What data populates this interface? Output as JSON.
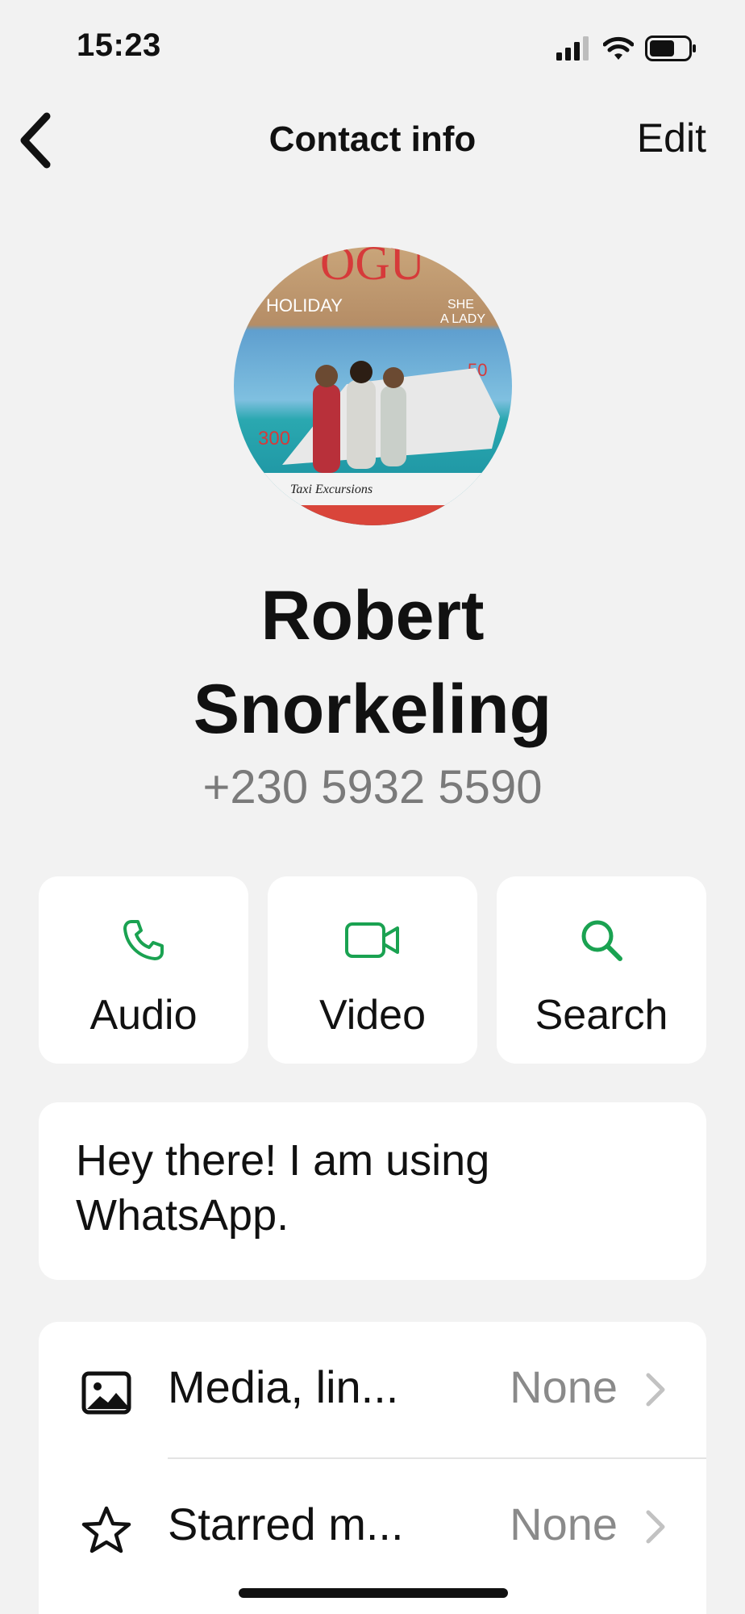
{
  "status_bar": {
    "time": "15:23"
  },
  "nav": {
    "title": "Contact info",
    "edit_label": "Edit"
  },
  "contact": {
    "name": "Robert Snorkeling",
    "phone": "+230 5932 5590"
  },
  "actions": [
    {
      "label": "Audio",
      "icon": "phone-icon"
    },
    {
      "label": "Video",
      "icon": "video-icon"
    },
    {
      "label": "Search",
      "icon": "search-icon"
    }
  ],
  "about": {
    "text": "Hey there! I am using WhatsApp."
  },
  "list": [
    {
      "label": "Media, lin...",
      "value": "None",
      "icon": "image-icon"
    },
    {
      "label": "Starred m...",
      "value": "None",
      "icon": "star-icon"
    }
  ],
  "colors": {
    "accent_green": "#1aa251",
    "background": "#f2f2f2",
    "secondary_text": "#7a7a7a"
  },
  "avatar": {
    "cover_text": [
      "OGU",
      "HOLIDAY",
      "SHE",
      "A LADY",
      "50",
      "300",
      "Taxi Excursions"
    ]
  }
}
